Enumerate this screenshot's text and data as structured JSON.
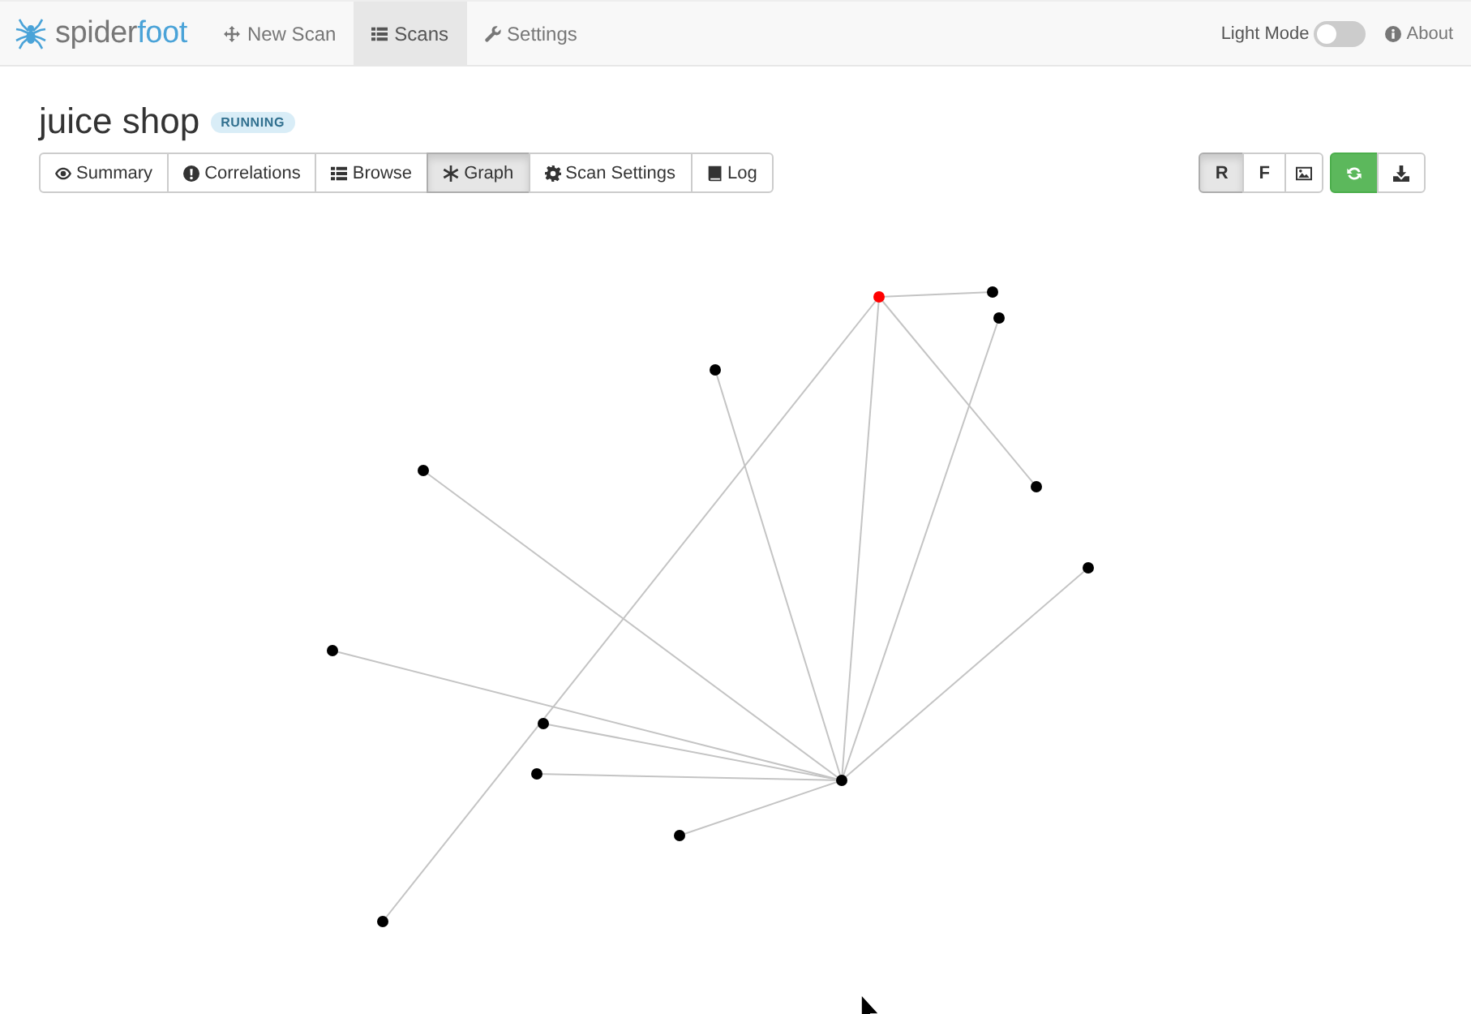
{
  "navbar": {
    "logo": {
      "part_1": "spider",
      "part_2": "foot"
    },
    "items": [
      {
        "label": "New Scan",
        "selected": false
      },
      {
        "label": "Scans",
        "selected": true
      },
      {
        "label": "Settings",
        "selected": false
      }
    ],
    "light_mode": {
      "label": "Light Mode",
      "on": false
    },
    "about": {
      "label": "About"
    }
  },
  "scan": {
    "title": "juice shop",
    "status": "RUNNING"
  },
  "tabs": [
    {
      "label": "Summary",
      "selected": false
    },
    {
      "label": "Correlations",
      "selected": false
    },
    {
      "label": "Browse",
      "selected": false
    },
    {
      "label": "Graph",
      "selected": true
    },
    {
      "label": "Scan Settings",
      "selected": false
    },
    {
      "label": "Log",
      "selected": false
    }
  ],
  "view_buttons": [
    {
      "label": "R",
      "selected": true
    },
    {
      "label": "F",
      "selected": false
    },
    {
      "selected": false
    }
  ],
  "auto_refresh": {
    "on": true
  },
  "graph": {
    "nodes": [
      {
        "color": "#000000"
      },
      {
        "color": "#ff0000"
      },
      {
        "color": "#000000"
      },
      {
        "color": "#000000"
      },
      {
        "color": "#000000"
      },
      {
        "color": "#000000"
      },
      {
        "color": "#000000"
      },
      {
        "color": "#000000"
      },
      {
        "color": "#000000"
      },
      {
        "color": "#000000"
      },
      {
        "color": "#000000"
      },
      {
        "color": "#000000"
      },
      {
        "color": "#000000"
      }
    ]
  }
}
